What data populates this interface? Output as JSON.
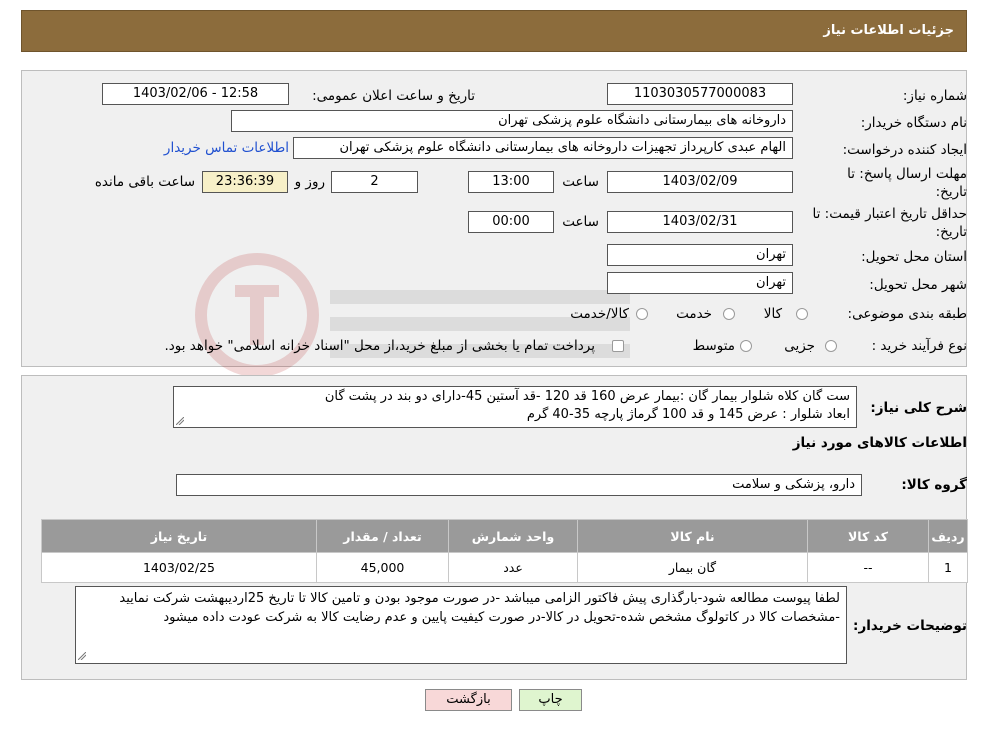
{
  "header": {
    "title": "جزئیات اطلاعات نیاز"
  },
  "form": {
    "need_number_label": "شماره نیاز:",
    "need_number": "1103030577000083",
    "announce_label": "تاریخ و ساعت اعلان عمومی:",
    "announce_value": "1403/02/06 - 12:58",
    "buyer_org_label": "نام دستگاه خریدار:",
    "buyer_org": "داروخانه های بیمارستانی دانشگاه علوم پزشکی تهران",
    "creator_label": "ایجاد کننده درخواست:",
    "creator": "الهام عبدی کارپرداز تجهیزات داروخانه های بیمارستانی دانشگاه علوم پزشکی تهران",
    "contact_link": "اطلاعات تماس خریدار",
    "deadline_label_1": "مهلت ارسال پاسخ: تا",
    "deadline_label_2": "تاریخ:",
    "deadline_date": "1403/02/09",
    "time_label": "ساعت",
    "deadline_time": "13:00",
    "days_value": "2",
    "days_label": "روز و",
    "remaining_time": "23:36:39",
    "remaining_label": "ساعت باقی مانده",
    "validity_label_1": "حداقل تاریخ اعتبار قیمت: تا",
    "validity_label_2": "تاریخ:",
    "validity_date": "1403/02/31",
    "validity_time": "00:00",
    "province_label": "استان محل تحویل:",
    "province": "تهران",
    "city_label": "شهر محل تحویل:",
    "city": "تهران",
    "category_label": "طبقه بندی موضوعی:",
    "category_options": [
      "کالا",
      "خدمت",
      "کالا/خدمت"
    ],
    "purchase_label": "نوع فرآیند خرید :",
    "purchase_options": [
      "جزیی",
      "متوسط"
    ],
    "purchase_note": "پرداخت تمام یا بخشی از مبلغ خرید،از محل \"اسناد خزانه اسلامی\" خواهد بود."
  },
  "details": {
    "description_label": "شرح کلی نیاز:",
    "description": "ست گان کلاه شلوار بیمار گان :بیمار عرض 160 قد 120 -قد آستین 45-دارای دو بند در پشت گان\nابعاد شلوار : عرض 145 و قد 100 گرماژ پارچه 35-40 گرم",
    "goods_info_title": "اطلاعات کالاهای مورد نیاز",
    "goods_group_label": "گروه کالا:",
    "goods_group": "دارو، پزشکی و سلامت",
    "table": {
      "headers": [
        "ردیف",
        "کد کالا",
        "نام کالا",
        "واحد شمارش",
        "تعداد / مقدار",
        "تاریخ نیاز"
      ],
      "rows": [
        [
          "1",
          "--",
          "گان بیمار",
          "عدد",
          "45,000",
          "1403/02/25"
        ]
      ]
    },
    "buyer_notes_label": "توضیحات خریدار:",
    "buyer_notes": "لطفا پیوست مطالعه شود-بارگذاری پیش فاکتور الزامی میباشد -در صورت موجود بودن و تامین کالا تا تاریخ 25اردیبهشت شرکت نمایید -مشخصات کالا در کاتولوگ مشخص شده-تحویل در کالا-در صورت کیفیت پایین و عدم رضایت کالا به شرکت عودت داده میشود"
  },
  "buttons": {
    "print": "چاپ",
    "back": "بازگشت"
  },
  "colors": {
    "header_bg": "#8c6c3c",
    "panel_bg": "#f0f0f0",
    "table_header_bg": "#9a9a9a",
    "link": "#2050d0",
    "back_button_bg": "#f8d8d8"
  }
}
